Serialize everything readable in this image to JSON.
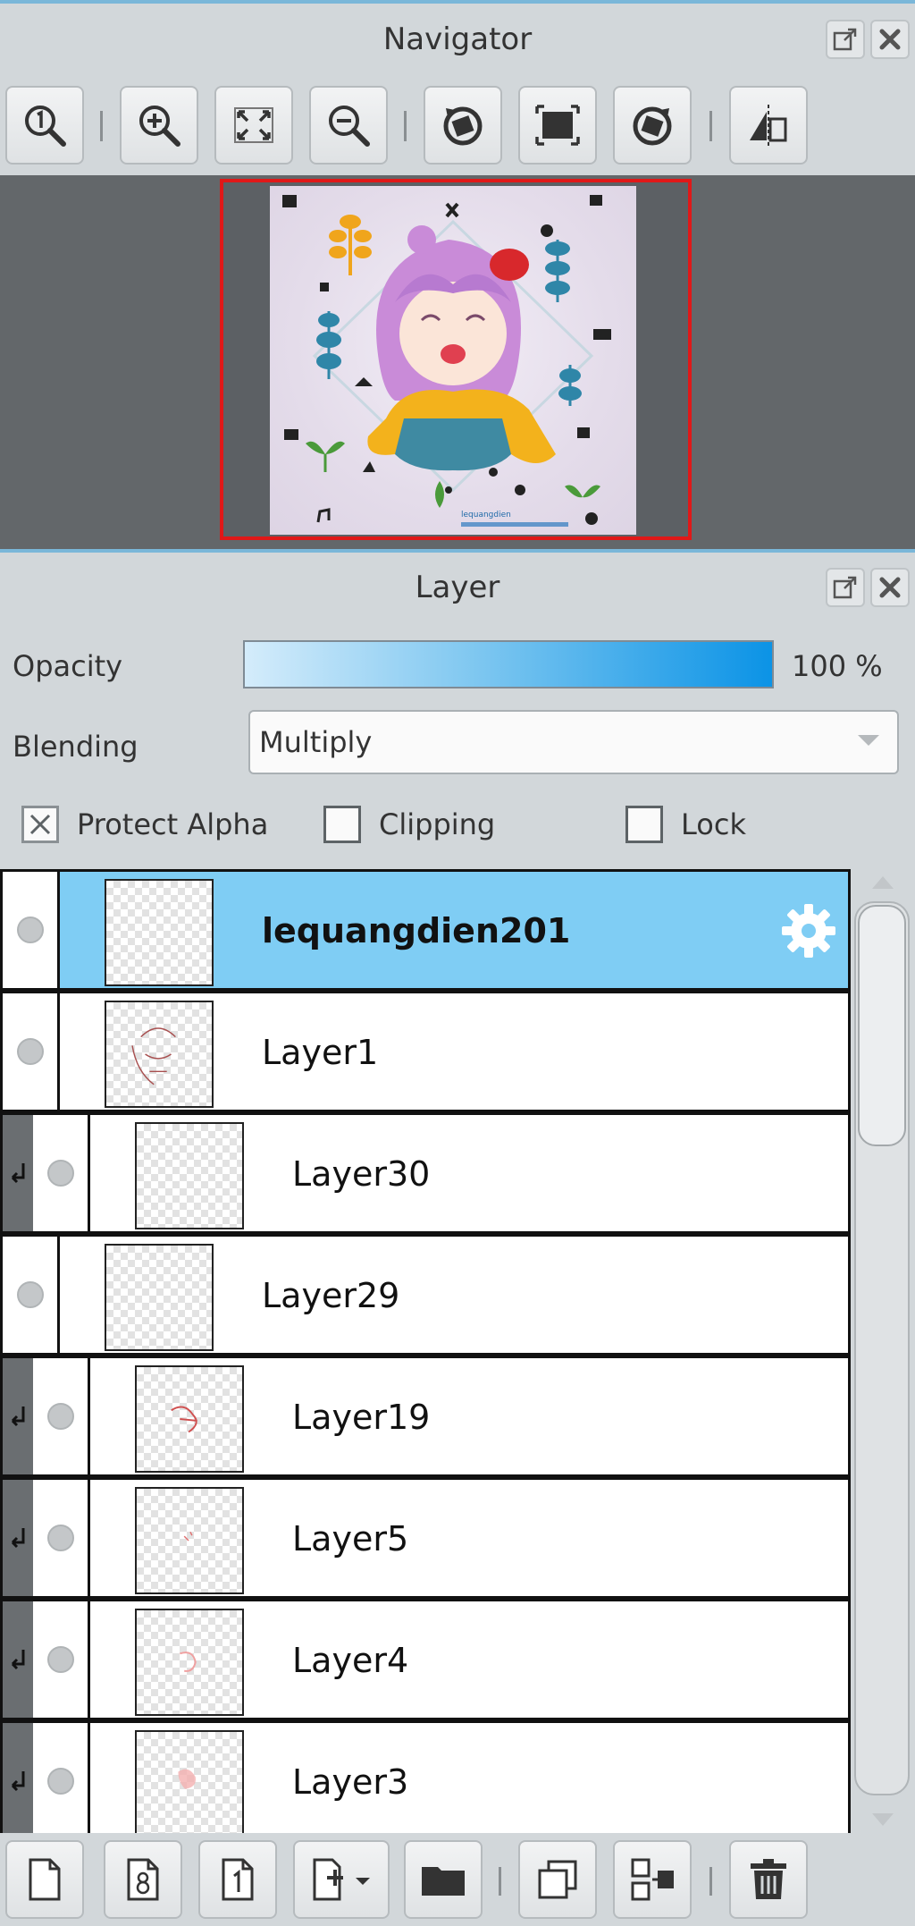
{
  "navigator": {
    "title": "Navigator",
    "toolbar": [
      {
        "name": "zoom-actual-size-button",
        "icon": "zoom-one-icon"
      },
      {
        "name": "zoom-in-button",
        "icon": "zoom-in-icon"
      },
      {
        "name": "fit-to-window-button",
        "icon": "fit-icon"
      },
      {
        "name": "zoom-out-button",
        "icon": "zoom-out-icon"
      },
      {
        "name": "rotate-left-button",
        "icon": "rotate-left-icon"
      },
      {
        "name": "reset-rotation-button",
        "icon": "reset-view-icon"
      },
      {
        "name": "rotate-right-button",
        "icon": "rotate-right-icon"
      },
      {
        "name": "flip-horizontal-button",
        "icon": "flip-icon"
      }
    ],
    "preview_watermark": "lequangdien"
  },
  "layer_panel": {
    "title": "Layer",
    "opacity_label": "Opacity",
    "opacity_value": "100 %",
    "opacity_fraction": 1.0,
    "blending_label": "Blending",
    "blending_value": "Multiply",
    "protect_alpha_label": "Protect Alpha",
    "protect_alpha_checked": true,
    "clipping_label": "Clipping",
    "clipping_checked": false,
    "lock_label": "Lock",
    "lock_checked": false,
    "layers": [
      {
        "name": "lequangdien201",
        "selected": true,
        "clipped": false
      },
      {
        "name": "Layer1",
        "selected": false,
        "clipped": false
      },
      {
        "name": "Layer30",
        "selected": false,
        "clipped": true
      },
      {
        "name": "Layer29",
        "selected": false,
        "clipped": false
      },
      {
        "name": "Layer19",
        "selected": false,
        "clipped": true
      },
      {
        "name": "Layer5",
        "selected": false,
        "clipped": true
      },
      {
        "name": "Layer4",
        "selected": false,
        "clipped": true
      },
      {
        "name": "Layer3",
        "selected": false,
        "clipped": true
      }
    ]
  },
  "bottom_toolbar": [
    {
      "name": "new-layer-button",
      "icon": "new-page-icon"
    },
    {
      "name": "new-8bit-layer-button",
      "icon": "page-8-icon"
    },
    {
      "name": "new-1bit-layer-button",
      "icon": "page-1-icon"
    },
    {
      "name": "add-layer-menu-button",
      "icon": "add-page-dropdown-icon"
    },
    {
      "name": "new-folder-button",
      "icon": "folder-icon"
    },
    {
      "name": "duplicate-layer-button",
      "icon": "duplicate-icon"
    },
    {
      "name": "merge-down-button",
      "icon": "merge-icon"
    },
    {
      "name": "delete-layer-button",
      "icon": "trash-icon"
    }
  ],
  "colors": {
    "accent": "#7ab7d9",
    "selected_row": "#7fcdf4",
    "nav_frame": "#e01818"
  }
}
